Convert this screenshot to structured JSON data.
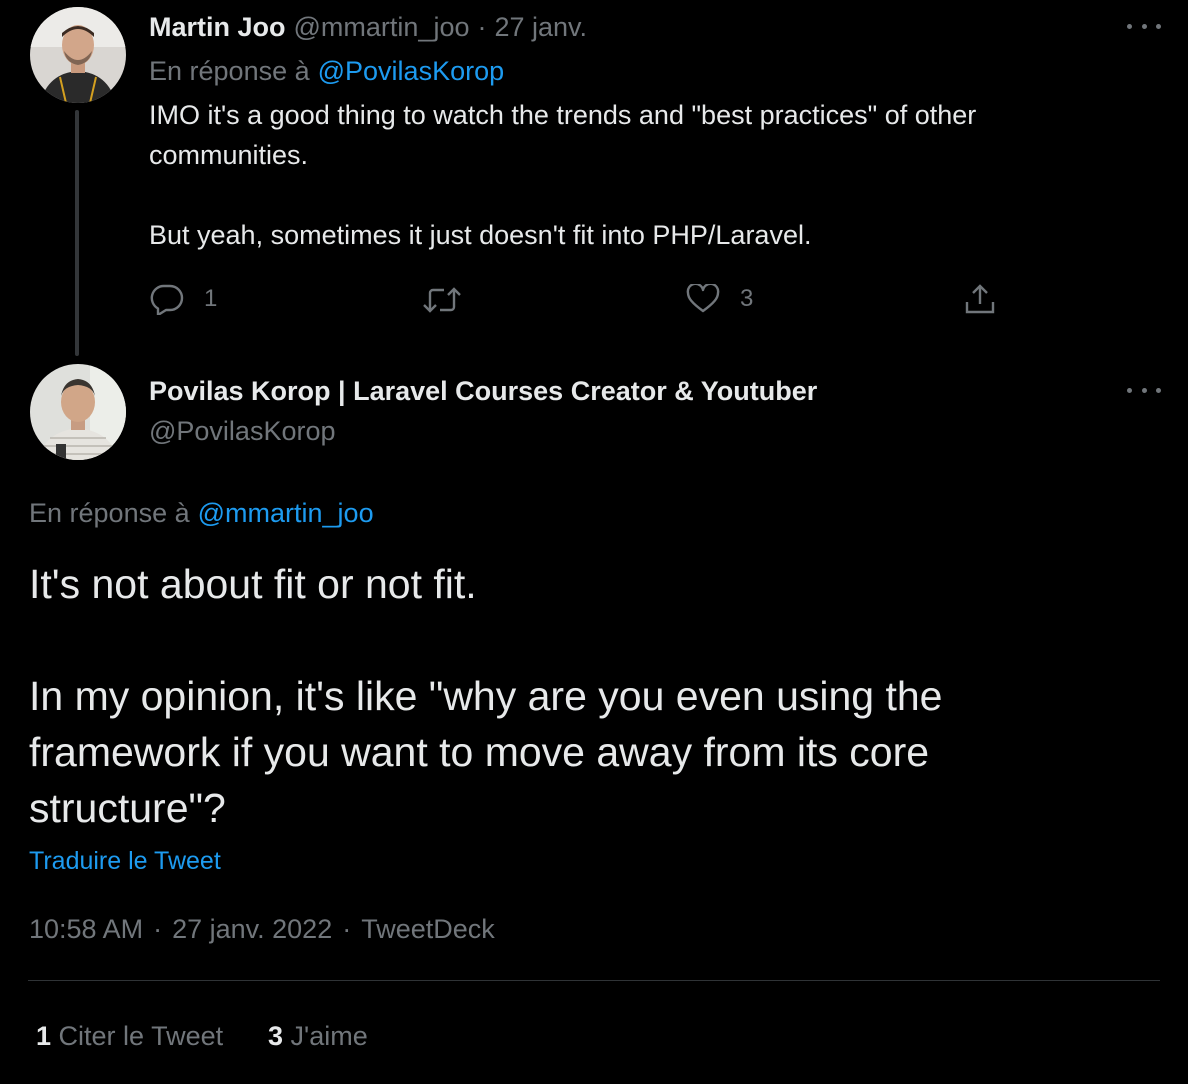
{
  "reply_tweet": {
    "author_name": "Martin Joo",
    "author_handle": "@mmartin_joo",
    "separator": "·",
    "date": "27 janv.",
    "replying_to_prefix": "En réponse à",
    "replying_to_handle": "@PovilasKorop",
    "text_line1": "IMO it's a good thing to watch the trends and \"best practices\" of other",
    "text_line2": "communities.",
    "text_line3": "But yeah, sometimes it just doesn't fit into PHP/Laravel.",
    "actions": {
      "reply_icon": "reply-icon",
      "reply_count": "1",
      "retweet_icon": "retweet-icon",
      "like_icon": "heart-icon",
      "like_count": "3",
      "share_icon": "share-icon"
    }
  },
  "main_tweet": {
    "author_name": "Povilas Korop | Laravel Courses Creator & Youtuber",
    "author_handle": "@PovilasKorop",
    "replying_to_prefix": "En réponse à",
    "replying_to_handle": "@mmartin_joo",
    "text_para1": "It's not about fit or not fit.",
    "text_para2_line1": "In my opinion, it's like \"why are you even using the",
    "text_para2_line2": "framework if you want to move away from its core",
    "text_para2_line3": "structure\"?",
    "translate_label": "Traduire le Tweet",
    "time": "10:58 AM",
    "date": "27 janv. 2022",
    "source": "TweetDeck",
    "separator": "·",
    "quote_count": "1",
    "quote_label": "Citer le Tweet",
    "like_count": "3",
    "like_label": "J'aime"
  },
  "colors": {
    "background": "#000000",
    "text": "#e7e9ea",
    "muted": "#71767b",
    "link": "#1d9bf0",
    "divider": "#2f3336"
  }
}
